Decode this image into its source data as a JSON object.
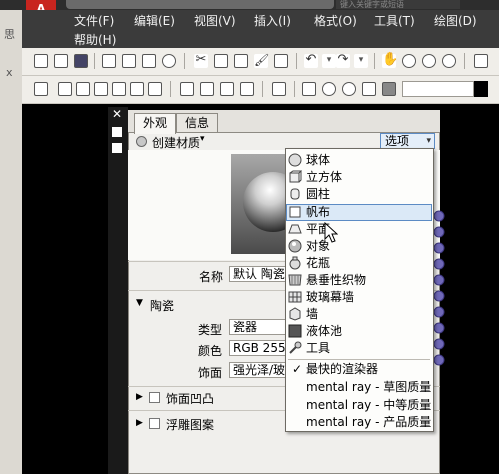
{
  "titlebar": {
    "app_logo": "A",
    "search_placeholder": "键入关键字或短语"
  },
  "menubar": {
    "row1": [
      "文件(F)",
      "编辑(E)",
      "视图(V)",
      "插入(I)",
      "格式(O)",
      "工具(T)",
      "绘图(D)"
    ],
    "row2": [
      "帮助(H)"
    ]
  },
  "left_edge_text": [
    "思",
    "x"
  ],
  "palette": {
    "close_glyph": "✕",
    "tabs": [
      "外观",
      "信息"
    ],
    "create_material_label": "创建材质",
    "options_label": "选项",
    "name_label": "名称",
    "name_value": "默认 陶瓷",
    "section_title": "陶瓷",
    "type_label": "类型",
    "type_value": "瓷器",
    "color_label": "颜色",
    "color_value": "RGB 255",
    "finish_label": "饰面",
    "finish_value": "强光泽/玻",
    "bump_label": "饰面凹凸",
    "relief_label": "浮雕图案"
  },
  "shape_menu": {
    "items": [
      {
        "label": "球体",
        "icon": "sphere-icon"
      },
      {
        "label": "立方体",
        "icon": "cube-icon"
      },
      {
        "label": "圆柱",
        "icon": "cylinder-icon"
      },
      {
        "label": "帆布",
        "icon": "canvas-icon",
        "selected": true
      },
      {
        "label": "平面",
        "icon": "plane-icon"
      },
      {
        "label": "对象",
        "icon": "object-icon"
      },
      {
        "label": "花瓶",
        "icon": "vase-icon"
      },
      {
        "label": "悬垂性织物",
        "icon": "fabric-icon"
      },
      {
        "label": "玻璃幕墙",
        "icon": "glass-wall-icon"
      },
      {
        "label": "墙",
        "icon": "wall-icon"
      },
      {
        "label": "液体池",
        "icon": "pool-icon"
      },
      {
        "label": "工具",
        "icon": "tool-icon"
      }
    ],
    "renderers": [
      {
        "label": "最快的渲染器",
        "checked": true
      },
      {
        "label": "mental ray - 草图质量",
        "checked": false
      },
      {
        "label": "mental ray - 中等质量",
        "checked": false
      },
      {
        "label": "mental ray - 产品质量",
        "checked": false
      }
    ]
  },
  "colors": {
    "menubar": "#3b3b3b",
    "highlight": "#dbe9f7",
    "accent": "#c8251f"
  }
}
